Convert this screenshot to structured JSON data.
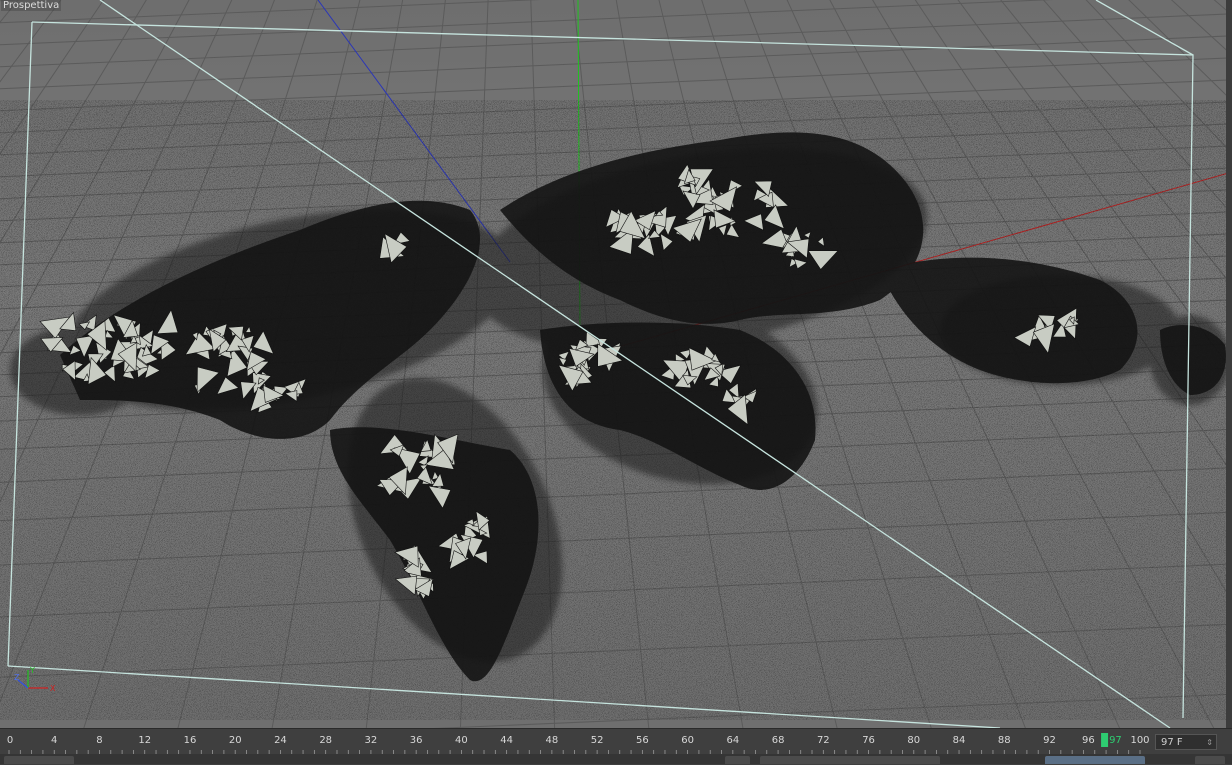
{
  "viewport": {
    "label": "Prospettiva",
    "axis_gizmo": {
      "x": "X",
      "y": "Y",
      "z": "Z"
    }
  },
  "timeline": {
    "ticks": [
      "0",
      "4",
      "8",
      "12",
      "16",
      "20",
      "24",
      "28",
      "32",
      "36",
      "40",
      "44",
      "48",
      "52",
      "56",
      "60",
      "64",
      "68",
      "72",
      "76",
      "80",
      "84",
      "88",
      "92",
      "96",
      "97",
      "100"
    ],
    "current_frame": "97",
    "frame_field": "97 F",
    "colors": {
      "playhead": "#2ecc71",
      "tick_text": "#d8d8d8"
    }
  },
  "colors": {
    "viewport_bg": "#747474",
    "grid": "#5d5d5d",
    "bounding_box": "#c8e6e0",
    "particles": "#1c1c1c",
    "shards": "#c9cdc5",
    "axis_x": "#c02020",
    "axis_y": "#20c020",
    "axis_z": "#2030c0"
  }
}
